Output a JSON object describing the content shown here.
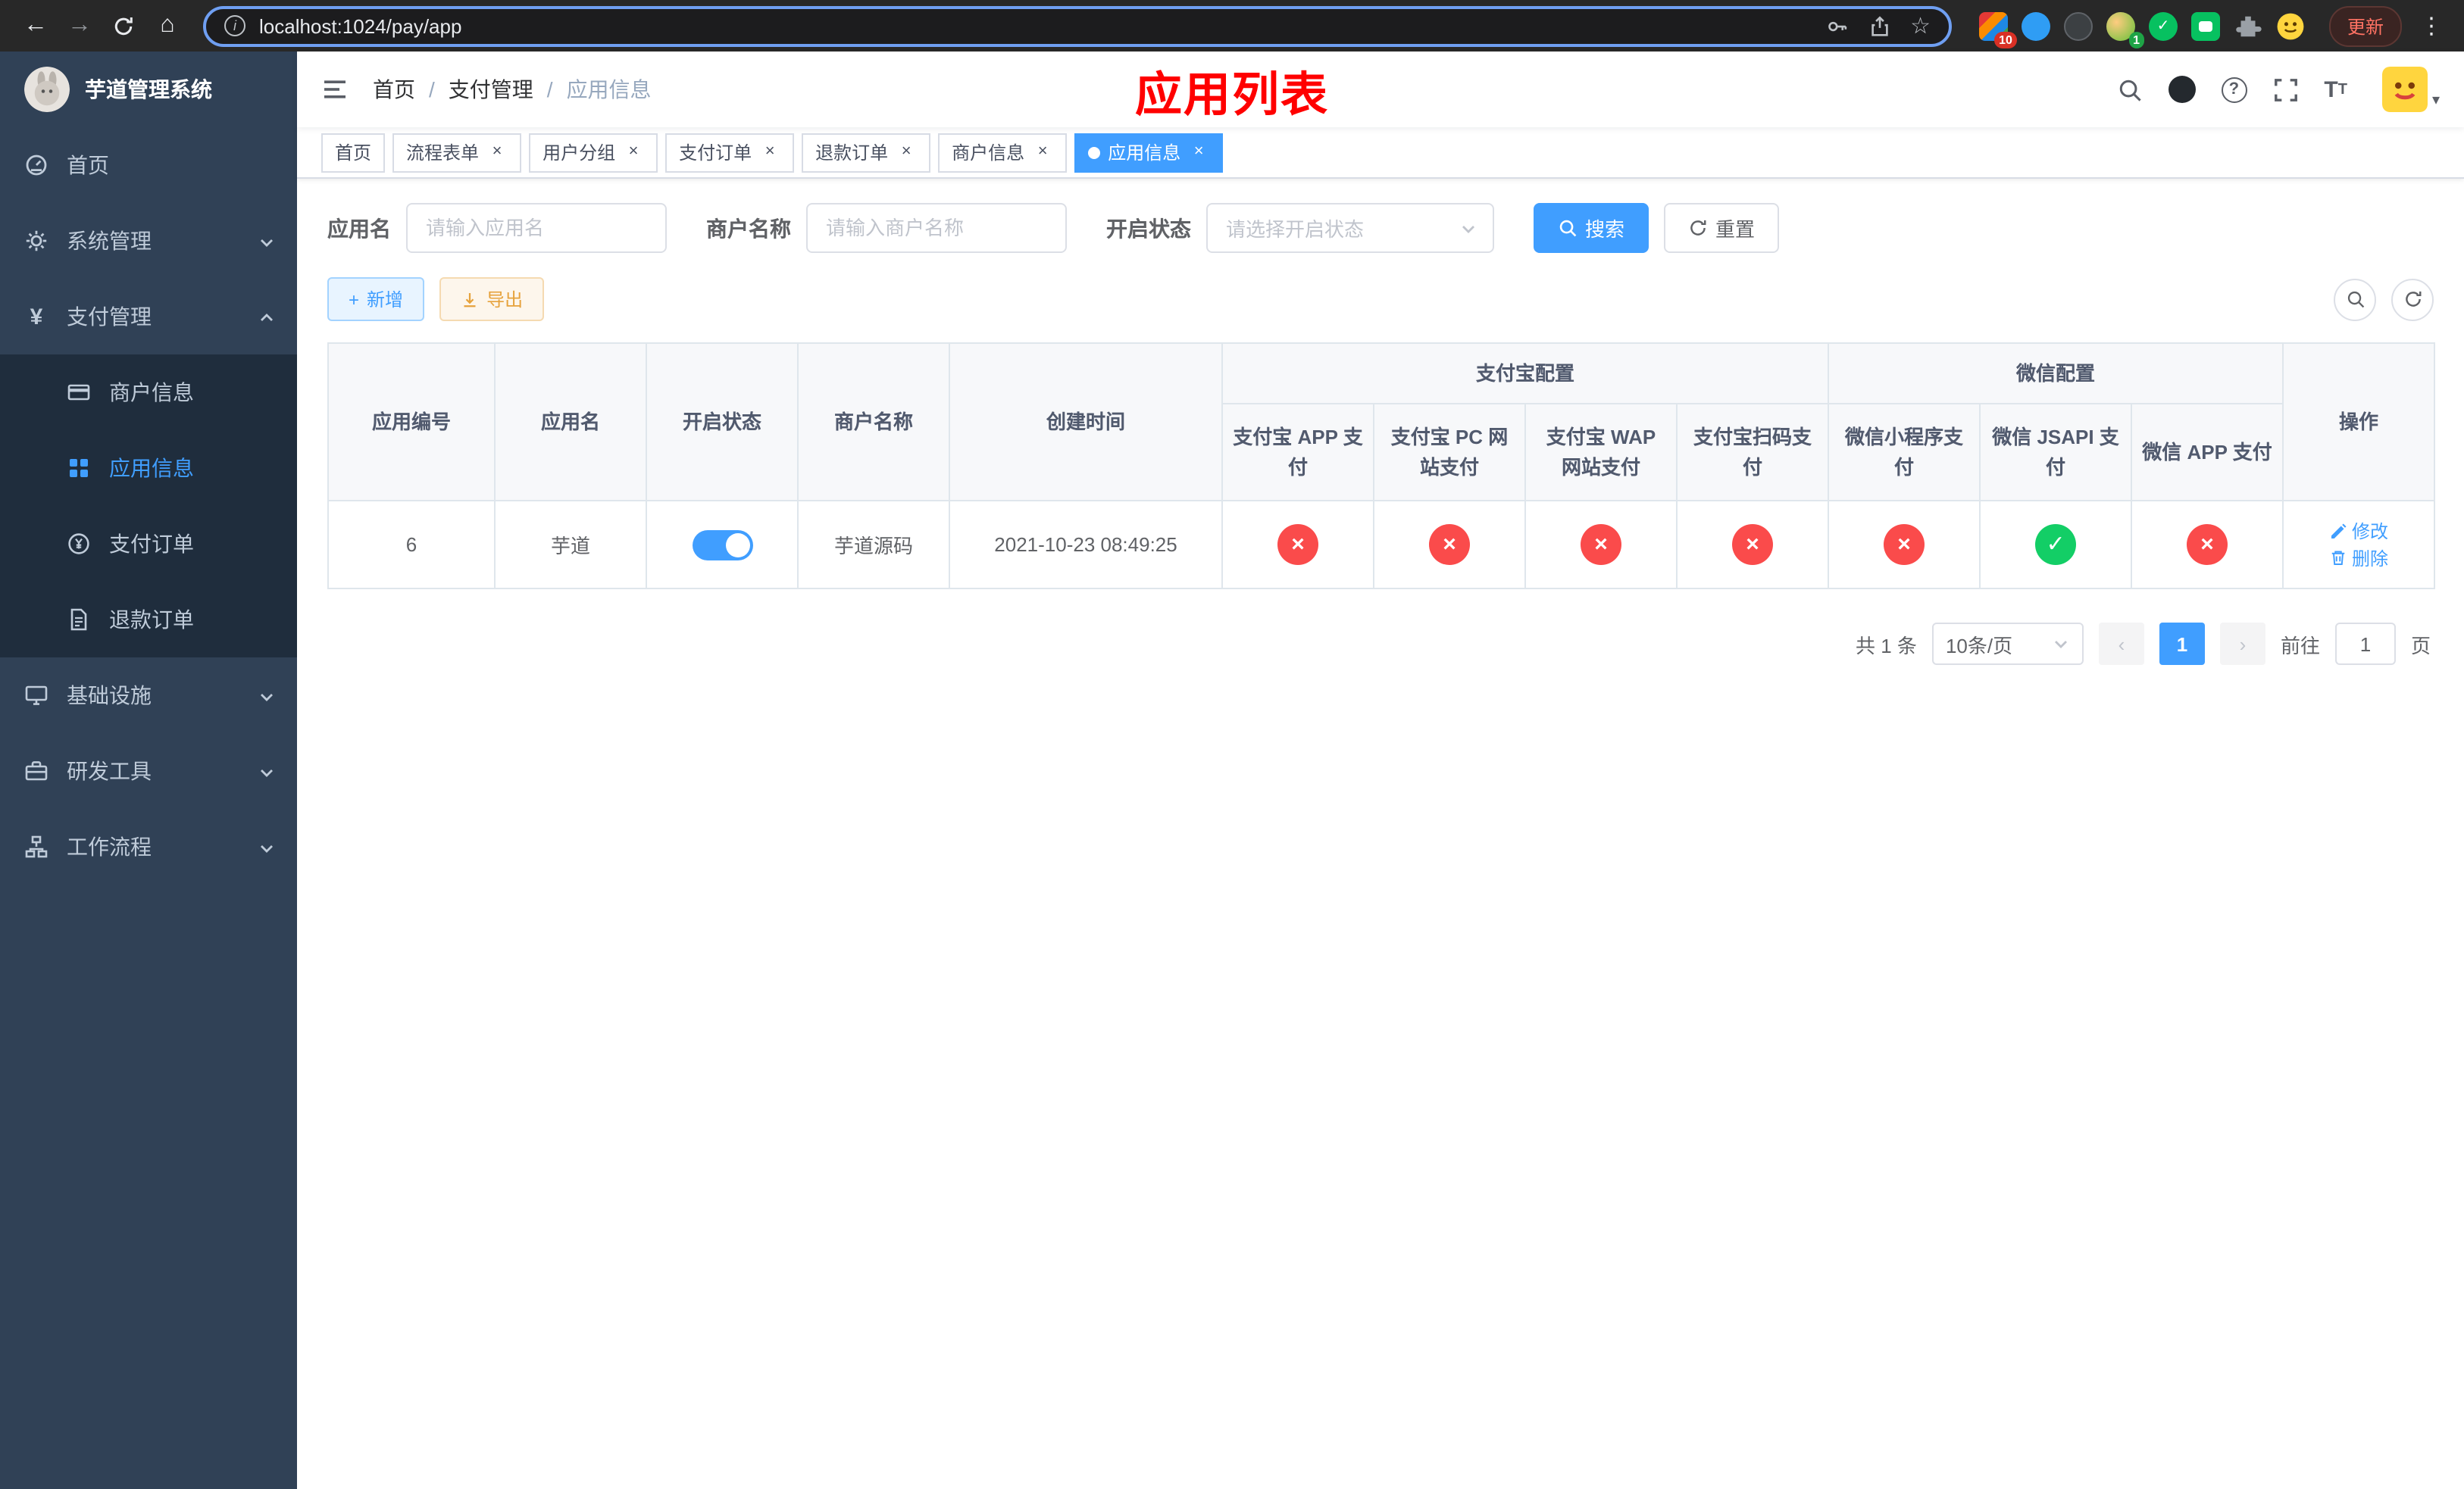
{
  "browser": {
    "url": "localhost:1024/pay/app",
    "update_label": "更新",
    "ext_badge_blocker": "10",
    "ext_badge_avatar": "1"
  },
  "sidebar": {
    "logo_title": "芋道管理系统",
    "items": [
      {
        "label": "首页"
      },
      {
        "label": "系统管理"
      },
      {
        "label": "支付管理"
      },
      {
        "label": "商户信息"
      },
      {
        "label": "应用信息"
      },
      {
        "label": "支付订单"
      },
      {
        "label": "退款订单"
      },
      {
        "label": "基础设施"
      },
      {
        "label": "研发工具"
      },
      {
        "label": "工作流程"
      }
    ]
  },
  "header": {
    "breadcrumb": {
      "home": "首页",
      "section": "支付管理",
      "current": "应用信息"
    },
    "page_title": "应用列表"
  },
  "tabs": {
    "items": [
      {
        "label": "首页"
      },
      {
        "label": "流程表单"
      },
      {
        "label": "用户分组"
      },
      {
        "label": "支付订单"
      },
      {
        "label": "退款订单"
      },
      {
        "label": "商户信息"
      },
      {
        "label": "应用信息"
      }
    ]
  },
  "filters": {
    "app_name_label": "应用名",
    "app_name_placeholder": "请输入应用名",
    "merchant_label": "商户名称",
    "merchant_placeholder": "请输入商户名称",
    "status_label": "开启状态",
    "status_placeholder": "请选择开启状态",
    "search_label": "搜索",
    "reset_label": "重置"
  },
  "toolbar": {
    "add_label": "新增",
    "export_label": "导出"
  },
  "table": {
    "headers": {
      "app_id": "应用编号",
      "app_name": "应用名",
      "status": "开启状态",
      "merchant": "商户名称",
      "created": "创建时间",
      "alipay_group": "支付宝配置",
      "wechat_group": "微信配置",
      "alipay_app": "支付宝 APP 支付",
      "alipay_pc": "支付宝 PC 网站支付",
      "alipay_wap": "支付宝 WAP 网站支付",
      "alipay_qr": "支付宝扫码支付",
      "wx_mini": "微信小程序支付",
      "wx_jsapi": "微信 JSAPI 支付",
      "wx_app": "微信 APP 支付",
      "actions": "操作"
    },
    "row": {
      "app_id": "6",
      "app_name": "芋道",
      "status_on": true,
      "merchant": "芋道源码",
      "created": "2021-10-23 08:49:25",
      "states": [
        false,
        false,
        false,
        false,
        false,
        true,
        false
      ],
      "edit_label": "修改",
      "delete_label": "删除"
    }
  },
  "pagination": {
    "total_text": "共 1 条",
    "page_size": "10条/页",
    "current_page": "1",
    "goto_prefix": "前往",
    "goto_value": "1",
    "goto_suffix": "页"
  }
}
